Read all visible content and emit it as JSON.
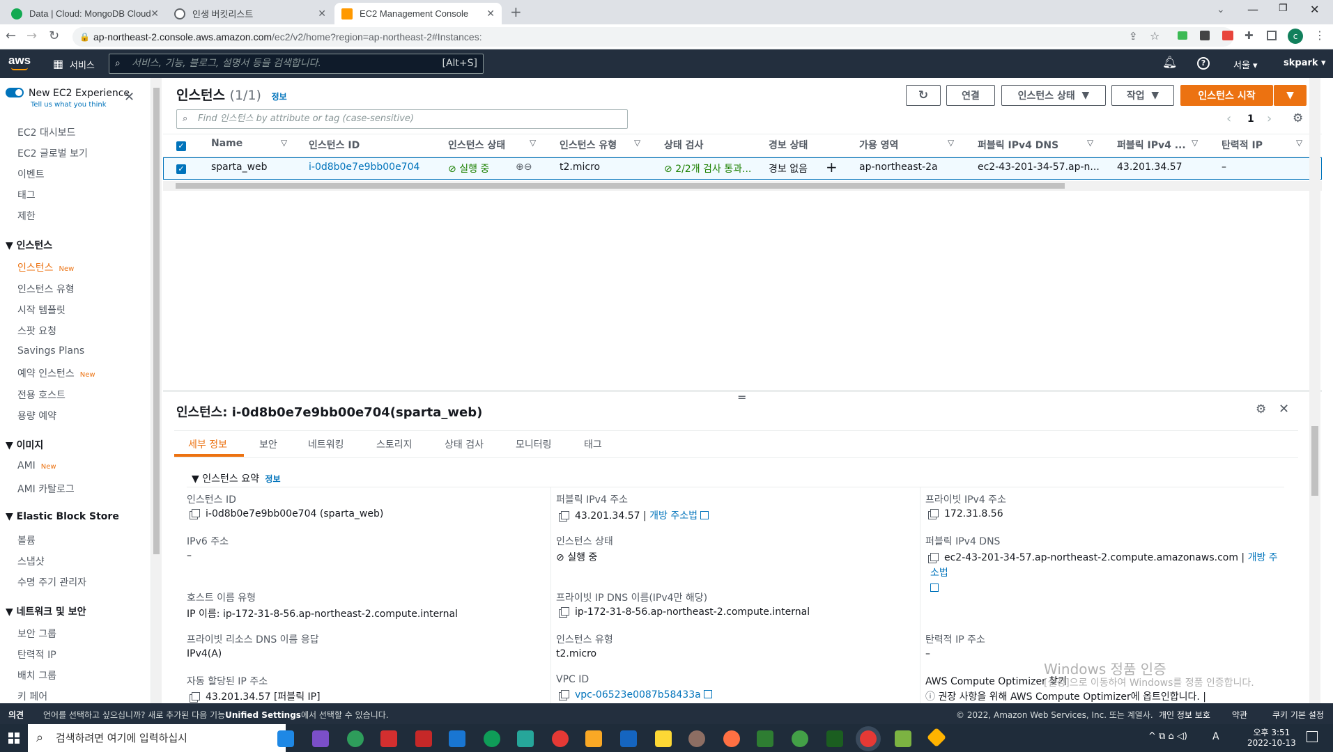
{
  "browser": {
    "tabs": [
      {
        "title": "Data | Cloud: MongoDB Cloud",
        "color": "#13aa52"
      },
      {
        "title": "인생 버킷리스트",
        "color": "#5f6368"
      },
      {
        "title": "EC2 Management Console",
        "color": "#ff9900"
      }
    ],
    "url_host": "ap-northeast-2.console.aws.amazon.com",
    "url_path": "/ec2/v2/home?region=ap-northeast-2#Instances:",
    "profile_initial": "c"
  },
  "aws_header": {
    "logo": "aws",
    "services_label": "서비스",
    "search_placeholder": "서비스, 기능, 블로그, 설명서 등을 검색합니다.",
    "search_shortcut": "[Alt+S]",
    "region": "서울",
    "user": "skpark"
  },
  "sidebar": {
    "new_experience_label": "New EC2 Experience",
    "new_experience_sub": "Tell us what you think",
    "top_items": [
      "EC2 대시보드",
      "EC2 글로벌 보기",
      "이벤트",
      "태그",
      "제한"
    ],
    "sections": [
      {
        "title": "인스턴스",
        "items": [
          {
            "label": "인스턴스",
            "badge": "New",
            "active": true
          },
          {
            "label": "인스턴스 유형"
          },
          {
            "label": "시작 템플릿"
          },
          {
            "label": "스팟 요청"
          },
          {
            "label": "Savings Plans"
          },
          {
            "label": "예약 인스턴스",
            "badge": "New"
          },
          {
            "label": "전용 호스트"
          },
          {
            "label": "용량 예약"
          }
        ]
      },
      {
        "title": "이미지",
        "items": [
          {
            "label": "AMI",
            "badge": "New"
          },
          {
            "label": "AMI 카탈로그"
          }
        ]
      },
      {
        "title": "Elastic Block Store",
        "items": [
          {
            "label": "볼륨"
          },
          {
            "label": "스냅샷"
          },
          {
            "label": "수명 주기 관리자"
          }
        ]
      },
      {
        "title": "네트워크 및 보안",
        "items": [
          {
            "label": "보안 그룹"
          },
          {
            "label": "탄력적 IP"
          },
          {
            "label": "배치 그룹"
          },
          {
            "label": "키 페어"
          }
        ]
      }
    ]
  },
  "instances": {
    "title": "인스턴스",
    "count": "(1/1)",
    "info": "정보",
    "btn_connect": "연결",
    "btn_state": "인스턴스 상태",
    "btn_actions": "작업",
    "btn_launch": "인스턴스 시작",
    "filter_placeholder": "Find 인스턴스 by attribute or tag (case-sensitive)",
    "page": "1",
    "columns": [
      "Name",
      "인스턴스 ID",
      "인스턴스 상태",
      "인스턴스 유형",
      "상태 검사",
      "경보 상태",
      "가용 영역",
      "퍼블릭 IPv4 DNS",
      "퍼블릭 IPv4 ...",
      "탄력적 IP"
    ],
    "row": {
      "name": "sparta_web",
      "id": "i-0d8b0e7e9bb00e704",
      "state": "실행 중",
      "type": "t2.micro",
      "check": "2/2개 검사 통과...",
      "alarm": "경보 없음",
      "az": "ap-northeast-2a",
      "dns": "ec2-43-201-34-57.ap-n...",
      "ipv4": "43.201.34.57",
      "eip": "–"
    }
  },
  "detail": {
    "title": "인스턴스: i-0d8b0e7e9bb00e704(sparta_web)",
    "tabs": [
      "세부 정보",
      "보안",
      "네트워킹",
      "스토리지",
      "상태 검사",
      "모니터링",
      "태그"
    ],
    "summary": "인스턴스 요약",
    "info": "정보",
    "fields": {
      "instance_id_label": "인스턴스 ID",
      "instance_id": "i-0d8b0e7e9bb00e704 (sparta_web)",
      "public_ip_label": "퍼블릭 IPv4 주소",
      "public_ip": "43.201.34.57",
      "open_address": "개방 주소법",
      "private_ip_label": "프라이빗 IPv4 주소",
      "private_ip": "172.31.8.56",
      "ipv6_label": "IPv6 주소",
      "ipv6": "–",
      "state_label": "인스턴스 상태",
      "state": "실행 중",
      "public_dns_label": "퍼블릭 IPv4 DNS",
      "public_dns": "ec2-43-201-34-57.ap-northeast-2.compute.amazonaws.com",
      "hostname_type_label": "호스트 이름 유형",
      "hostname_type": "IP 이름: ip-172-31-8-56.ap-northeast-2.compute.internal",
      "private_dns_label": "프라이빗 IP DNS 이름(IPv4만 해당)",
      "private_dns": "ip-172-31-8-56.ap-northeast-2.compute.internal",
      "private_resource_dns_label": "프라이빗 리소스 DNS 이름 응답",
      "private_resource_dns": "IPv4(A)",
      "type_label": "인스턴스 유형",
      "type": "t2.micro",
      "eip_label": "탄력적 IP 주소",
      "eip": "–",
      "auto_ip_label": "자동 할당된 IP 주소",
      "auto_ip": "43.201.34.57 [퍼블릭 IP]",
      "vpc_label": "VPC ID",
      "vpc": "vpc-06523e0087b58433a",
      "optimizer_label": "AWS Compute Optimizer 찾기",
      "optimizer": "권장 사항을 위해 AWS Compute Optimizer에 옵트인합니다. |"
    }
  },
  "watermark": {
    "line1": "Windows 정품 인증",
    "line2": "[설정]으로 이동하여 Windows를 정품 인증합니다."
  },
  "footer": {
    "feedback": "의견",
    "lang_prefix": "언어를 선택하고 싶으십니까? 새로 추가된 다음 기능",
    "unified": "Unified Settings",
    "lang_suffix": "에서 선택할 수 있습니다.",
    "copyright": "© 2022, Amazon Web Services, Inc. 또는 계열사.",
    "privacy": "개인 정보 보호",
    "terms": "약관",
    "cookie": "쿠키 기본 설정"
  },
  "taskbar": {
    "search": "검색하려면 여기에 입력하십시",
    "time": "오후 3:51",
    "date": "2022-10-13",
    "ime": "A"
  }
}
